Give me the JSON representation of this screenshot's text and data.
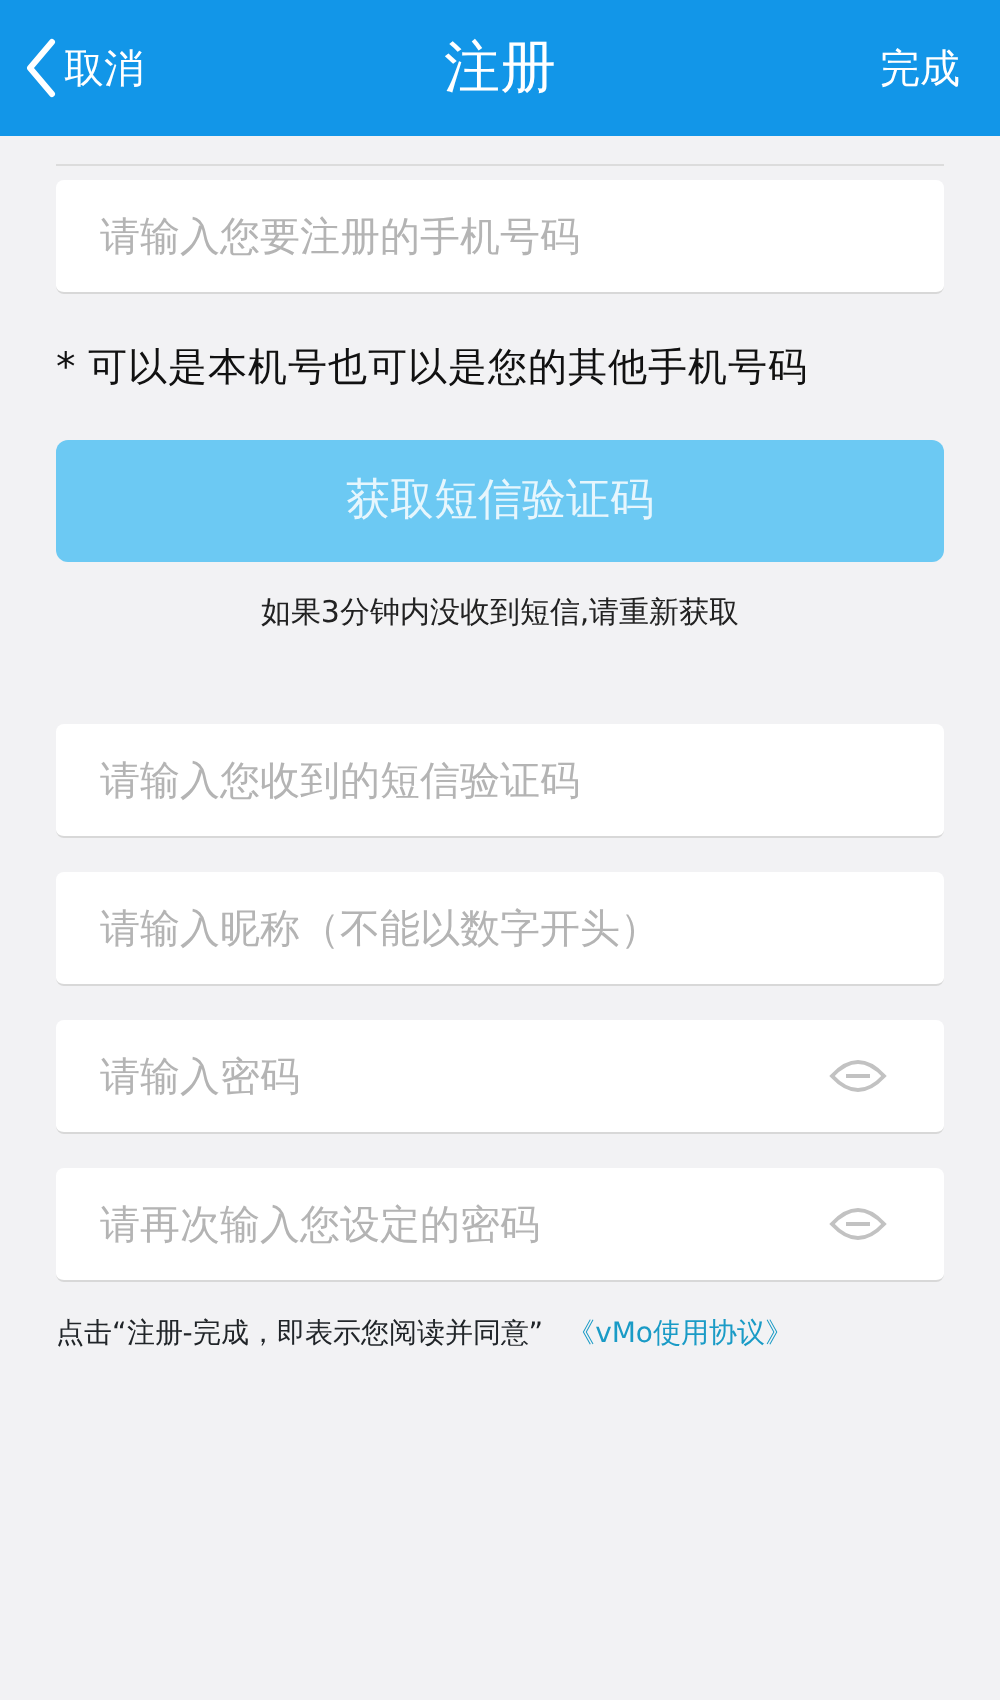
{
  "header": {
    "back_label": "取消",
    "title": "注册",
    "done_label": "完成"
  },
  "phone_field": {
    "placeholder": "请输入您要注册的手机号码"
  },
  "phone_note": "* 可以是本机号也可以是您的其他手机号码",
  "sms_button": {
    "label": "获取短信验证码",
    "disabled": true
  },
  "sms_hint": "如果3分钟内没收到短信,请重新获取",
  "fields": [
    {
      "kind": "text",
      "placeholder": "请输入您收到的短信验证码"
    },
    {
      "kind": "text",
      "placeholder": "请输入昵称（不能以数字开头）"
    },
    {
      "kind": "password",
      "placeholder": "请输入密码"
    },
    {
      "kind": "password",
      "placeholder": "请再次输入您设定的密码"
    }
  ],
  "agreement": {
    "text": "点击“注册-完成，即表示您阅读并同意”",
    "link": "《vMo使用协议》"
  }
}
